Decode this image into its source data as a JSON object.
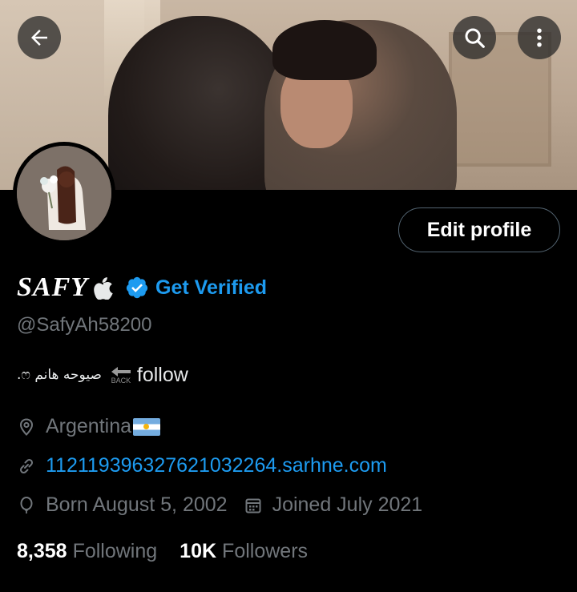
{
  "header": {
    "back_icon": "arrow-left-icon",
    "search_icon": "search-icon",
    "more_icon": "more-vertical-icon"
  },
  "profile": {
    "display_name": "SAFY",
    "name_emoji_icon": "apple-icon",
    "verified_icon": "verified-badge-icon",
    "get_verified_label": "Get Verified",
    "handle": "@SafyAh58200",
    "edit_profile_label": "Edit profile",
    "bio": {
      "arabic_text": ".ෆ صيوحه هانم",
      "back_label": "BACK",
      "follow_text": "follow"
    },
    "location": "Argentina",
    "website": "112119396327621032264.sarhne.com",
    "born": "Born August 5, 2002",
    "joined": "Joined July 2021",
    "following_count": "8,358",
    "following_label": "Following",
    "followers_count": "10K",
    "followers_label": "Followers"
  },
  "colors": {
    "accent": "#1d9bf0",
    "background": "#000000",
    "secondary_text": "#71767b"
  }
}
